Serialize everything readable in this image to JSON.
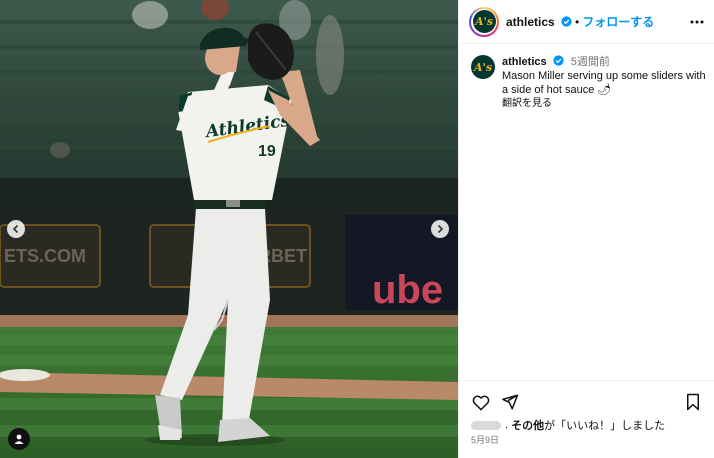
{
  "photo": {
    "jersey_script": "Athletics",
    "jersey_number": "19",
    "signboard_text": "ube",
    "signboard_left": "ETS.COM",
    "signboard_mid": "RBET"
  },
  "header": {
    "username": "athletics",
    "separator": "•",
    "follow_label": "フォローする"
  },
  "caption": {
    "username": "athletics",
    "time_ago": "5週間前",
    "text": "Mason Miller serving up some sliders with a side of hot sauce 🌶",
    "translate_label": "翻訳を見る"
  },
  "likes": {
    "sep": ".",
    "others_label": "その他",
    "text": "が「いいね！」しました"
  },
  "date": "5月9日",
  "avatar_logo_text": "A's",
  "colors": {
    "accent": "#0095f6",
    "team_green": "#003831",
    "team_gold": "#efb21e"
  },
  "icons": [
    "chevron-left-icon",
    "chevron-right-icon",
    "user-tag-icon",
    "verified-badge-icon",
    "more-options-icon",
    "heart-icon",
    "share-icon",
    "bookmark-icon"
  ]
}
